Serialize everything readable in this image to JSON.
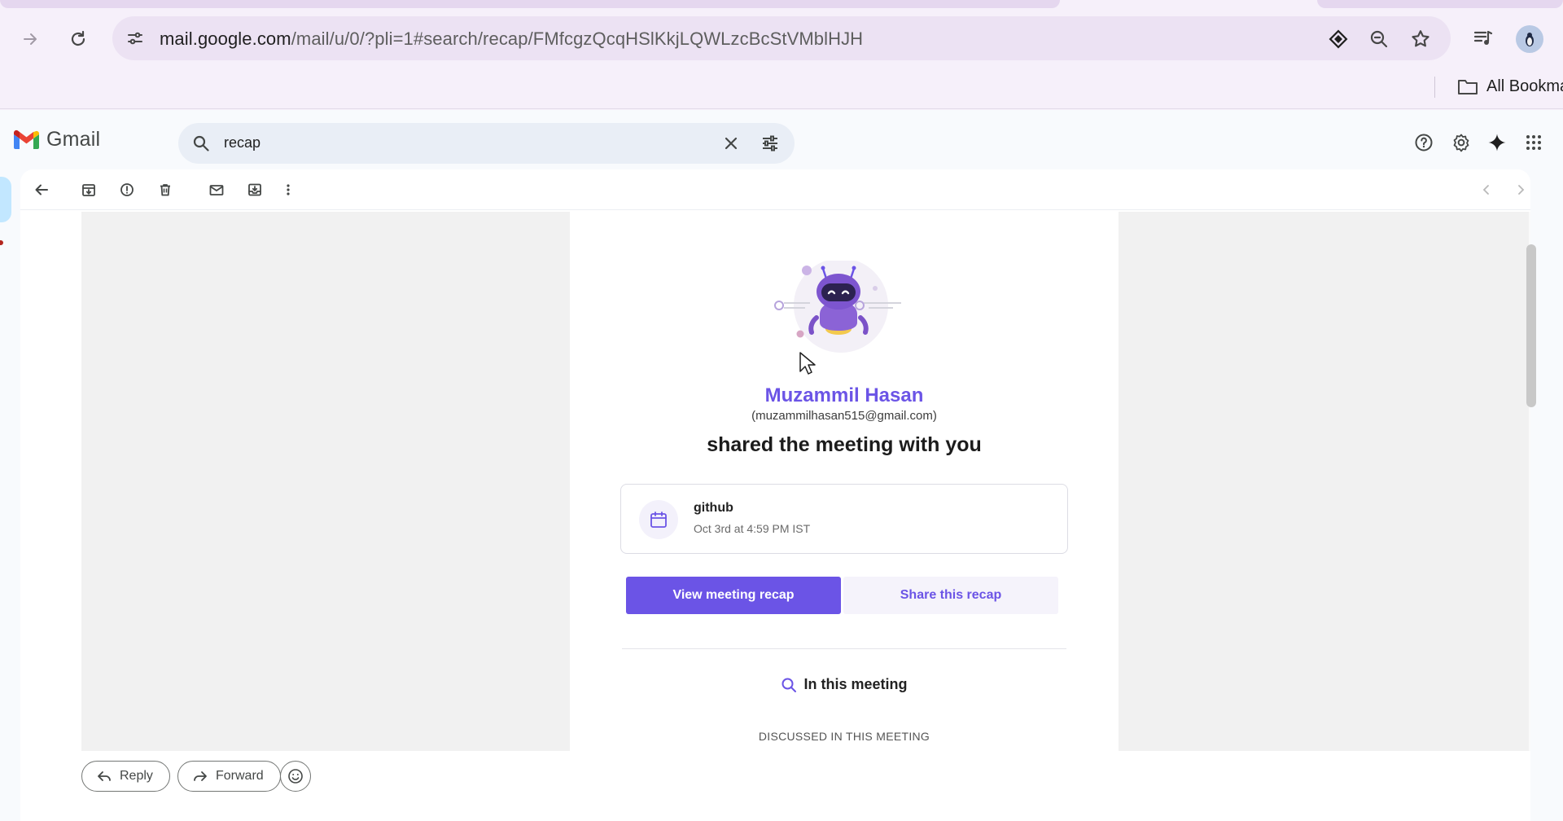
{
  "browser": {
    "url_host": "mail.google.com",
    "url_path": "/mail/u/0/?pli=1#search/recap/FMfcgzQcqHSlKkjLQWLzcBcStVMblHJH",
    "bookmarks_label": "All Bookmarks",
    "icons": [
      "back-arrow-icon",
      "forward-arrow-icon",
      "reload-icon",
      "site-info-icon",
      "gemini-diamond-icon",
      "zoom-out-icon",
      "bookmark-star-icon",
      "media-playlist-icon",
      "profile-avatar",
      "folder-icon"
    ]
  },
  "gmail": {
    "logo_text": "Gmail",
    "search": {
      "value": "recap",
      "icons": [
        "search-icon",
        "clear-icon",
        "search-options-icon"
      ]
    },
    "header_icons": [
      "help-icon",
      "settings-gear-icon",
      "gemini-sparkle-icon",
      "apps-grid-icon"
    ],
    "action_icons": [
      "back-arrow-icon",
      "archive-icon",
      "report-spam-icon",
      "delete-icon",
      "mark-unread-icon",
      "move-to-icon",
      "more-vertical-icon",
      "newer-chevron-icon",
      "older-chevron-icon"
    ]
  },
  "email": {
    "sender_name": "Muzammil Hasan",
    "sender_email": "(muzammilhasan515@gmail.com)",
    "headline": "shared the meeting with you",
    "meeting": {
      "title": "github",
      "date": "Oct 3rd at 4:59 PM IST"
    },
    "buttons": {
      "view": "View meeting recap",
      "share": "Share this recap"
    },
    "section_title": "In this meeting",
    "section_subtitle": "DISCUSSED IN THIS MEETING"
  },
  "reply_bar": {
    "reply": "Reply",
    "forward": "Forward"
  },
  "colors": {
    "accent": "#6b54e6",
    "chrome_bg": "#f6f0fa",
    "omnibox_bg": "#ece2f3",
    "gmail_search_bg": "#e9eef6"
  }
}
